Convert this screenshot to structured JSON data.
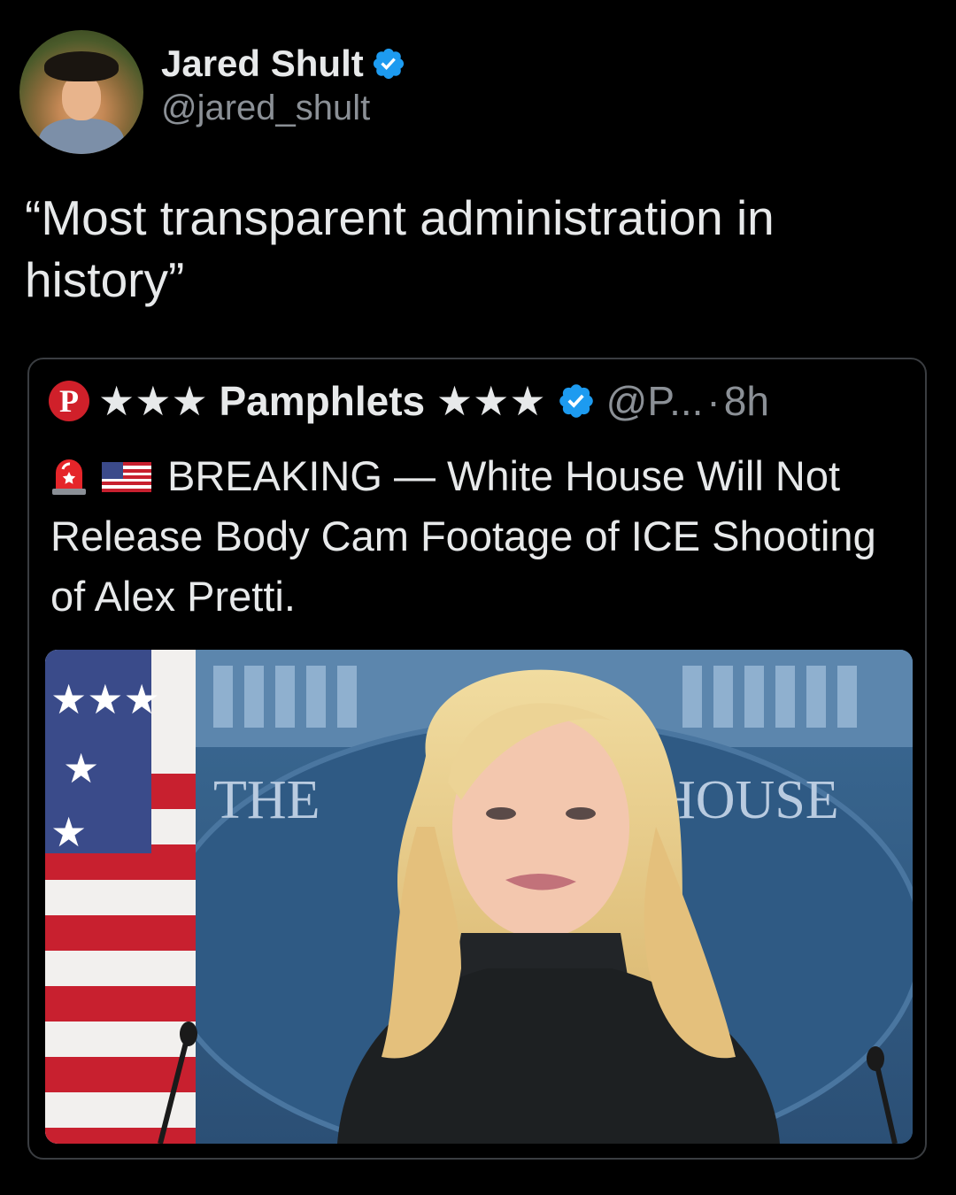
{
  "author": {
    "display_name": "Jared Shult",
    "handle": "@jared_shult",
    "verified": true
  },
  "tweet": {
    "text": "“Most transparent administration in history”"
  },
  "quoted_tweet": {
    "display_name": "★★★ Pamphlets ★★★",
    "logo_letter": "P",
    "handle": "@P...",
    "separator": "·",
    "time": "8h",
    "verified": true,
    "text_prefix": "BREAKING — White House Will",
    "text_rest": "Not Release Body Cam Footage of ICE Shooting of Alex Pretti.",
    "emojis": [
      "siren-emoji",
      "us-flag-emoji"
    ],
    "media": {
      "backdrop_text_left": "THE",
      "backdrop_text_right": "HOUSE"
    }
  },
  "colors": {
    "background": "#000000",
    "text": "#e7e9ea",
    "secondary": "#8b9096",
    "verified": "#1d9bf0",
    "border": "#3a3d41",
    "logo_red": "#d0202a"
  }
}
